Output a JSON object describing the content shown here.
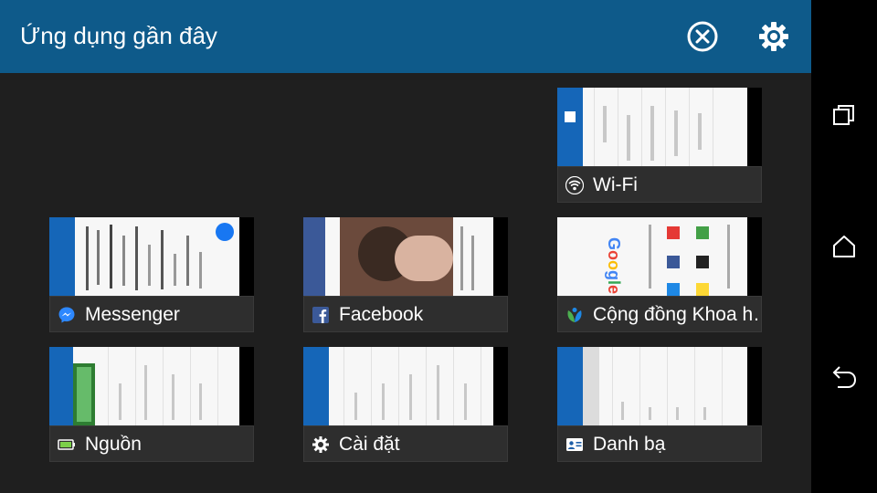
{
  "header": {
    "title": "Ứng dụng gần đây",
    "close_all_icon": "close-circle-icon",
    "settings_icon": "gear-icon"
  },
  "recent_apps": [
    {
      "label": "Wi-Fi",
      "icon": "wifi-icon"
    },
    {
      "label": "Messenger",
      "icon": "messenger-icon"
    },
    {
      "label": "Facebook",
      "icon": "facebook-icon"
    },
    {
      "label": "Cộng đồng Khoa h…",
      "icon": "community-icon"
    },
    {
      "label": "Nguồn",
      "icon": "battery-icon"
    },
    {
      "label": "Cài đặt",
      "icon": "gear-icon"
    },
    {
      "label": "Danh bạ",
      "icon": "contacts-icon"
    }
  ],
  "navbar": {
    "recents_icon": "recents-icon",
    "home_icon": "home-icon",
    "back_icon": "back-icon"
  },
  "colors": {
    "header": "#0e5a8a",
    "background": "#1f1f1f",
    "navbar": "#000000",
    "label_bg": "#2e2e2e"
  }
}
